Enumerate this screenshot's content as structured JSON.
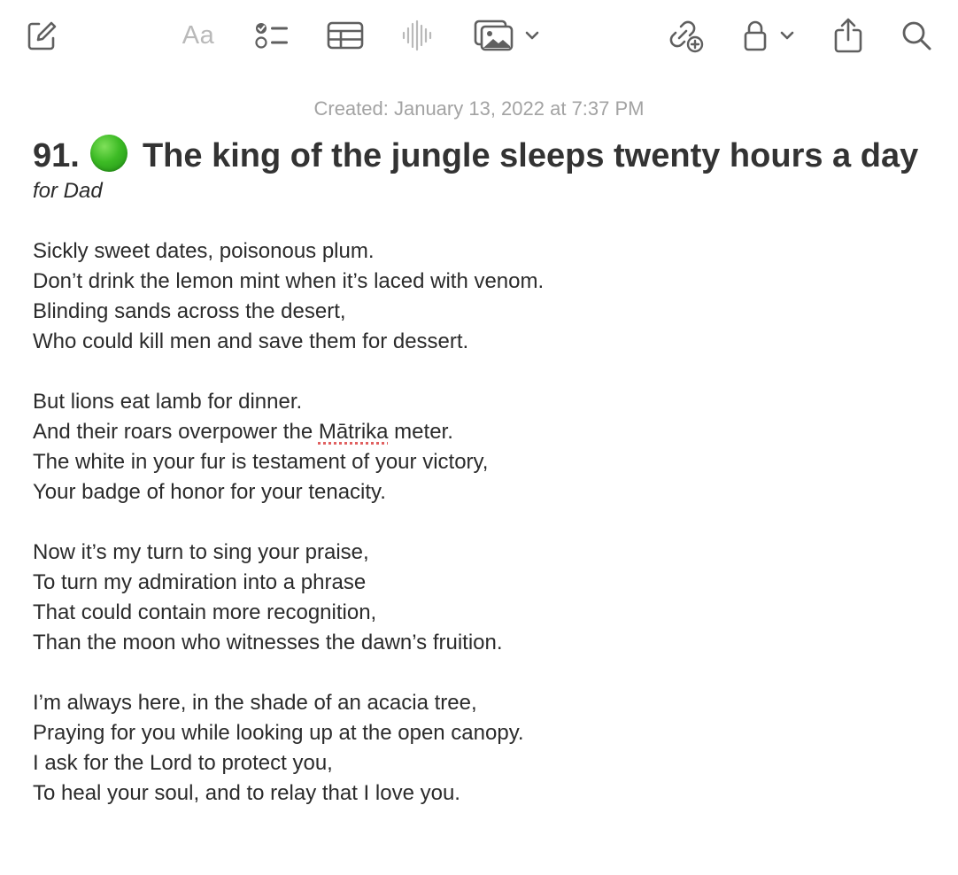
{
  "toolbar": {
    "format_label": "Aa",
    "icons": [
      "compose-icon",
      "format-text-icon",
      "checklist-icon",
      "table-icon",
      "audio-waveform-icon",
      "media-icon",
      "chevron-down-icon",
      "collaborate-icon",
      "lock-icon",
      "chevron-down-icon",
      "share-icon",
      "search-icon"
    ]
  },
  "note": {
    "created": "Created: January 13, 2022 at 7:37 PM",
    "title_prefix": "91.",
    "title_emoji": "green-circle",
    "title_text": "The king of the jungle sleeps twenty hours a day",
    "subtitle": "for Dad",
    "stanzas": [
      {
        "lines": [
          "Sickly sweet dates, poisonous plum.",
          "Don’t drink the lemon mint when it’s laced with venom.",
          "Blinding sands across the desert,",
          "Who could kill men and save them for dessert."
        ]
      },
      {
        "lines": [
          "But lions eat lamb for dinner.",
          {
            "before": "And their roars overpower the ",
            "misspelled": "Mātrika",
            "after": " meter."
          },
          "The white in your fur is testament of your victory,",
          "Your badge of honor for your tenacity."
        ]
      },
      {
        "lines": [
          "Now it’s my turn to sing your praise,",
          "To turn my admiration into a phrase",
          "That could contain more recognition,",
          "Than the moon who witnesses the dawn’s fruition."
        ]
      },
      {
        "lines": [
          "I’m always here, in the shade of an acacia tree,",
          "Praying for you while looking up at the open canopy.",
          "I ask for the Lord to protect you,",
          "To heal your soul, and to relay that I love you."
        ]
      }
    ]
  },
  "colors": {
    "icon": "#5f5f5f",
    "icon_disabled": "#b9b9b9",
    "created_text": "#a3a3a3",
    "title_text": "#333333",
    "body_text": "#2b2b2b",
    "green_dot": "#3dbb25",
    "spellcheck_underline": "#e06060"
  }
}
